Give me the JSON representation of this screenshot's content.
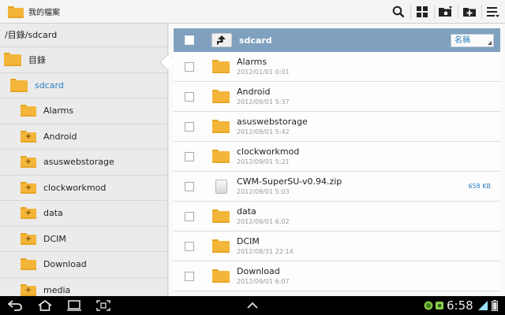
{
  "app": {
    "title": "我的檔案",
    "accent": "#2a7ec0",
    "folder_color": "#f3b63a"
  },
  "toolbar": {
    "icons": [
      "search-icon",
      "grid-view-icon",
      "home-folder-icon",
      "add-folder-icon",
      "menu-icon"
    ]
  },
  "left_panel": {
    "path": "/目錄/sdcard",
    "items": [
      {
        "label": "目錄",
        "plus": ""
      },
      {
        "label": "sdcard",
        "plus": ""
      },
      {
        "label": "Alarms",
        "plus": ""
      },
      {
        "label": "Android",
        "plus": "+"
      },
      {
        "label": "asuswebstorage",
        "plus": "+"
      },
      {
        "label": "clockworkmod",
        "plus": "+"
      },
      {
        "label": "data",
        "plus": "+"
      },
      {
        "label": "DCIM",
        "plus": "+"
      },
      {
        "label": "Download",
        "plus": ""
      },
      {
        "label": "media",
        "plus": "+"
      }
    ]
  },
  "right_panel": {
    "title": "sdcard",
    "sort_label": "名稱",
    "files": [
      {
        "name": "Alarms",
        "date": "2012/01/01 0:01",
        "size": ""
      },
      {
        "name": "Android",
        "date": "2012/09/01 5:37",
        "size": ""
      },
      {
        "name": "asuswebstorage",
        "date": "2012/09/01 5:42",
        "size": ""
      },
      {
        "name": "clockworkmod",
        "date": "2012/09/01 5:21",
        "size": ""
      },
      {
        "name": "CWM-SuperSU-v0.94.zip",
        "date": "2012/09/01 5:03",
        "size": "658 KB"
      },
      {
        "name": "data",
        "date": "2012/09/01 6:02",
        "size": ""
      },
      {
        "name": "DCIM",
        "date": "2012/08/31 22:14",
        "size": ""
      },
      {
        "name": "Download",
        "date": "2012/09/01 6:07",
        "size": ""
      }
    ]
  },
  "status_bar": {
    "time": "6:58"
  }
}
